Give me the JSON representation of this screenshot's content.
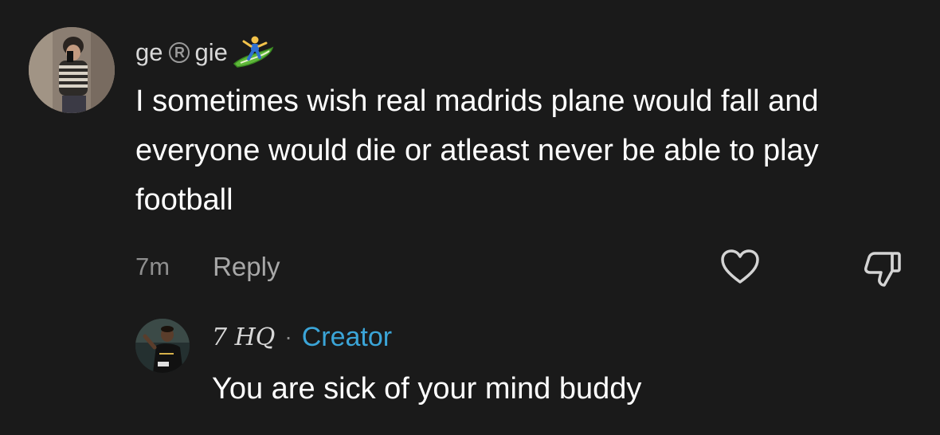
{
  "comment": {
    "username_part1": "ge",
    "registered_symbol": "R",
    "username_part2": "gie",
    "username_emoji": "surfer-icon",
    "text": "I sometimes wish real madrids plane would fall and everyone would die or atleast never be able to play football",
    "timestamp": "7m",
    "reply_label": "Reply",
    "like_icon": "heart-outline-icon",
    "dislike_icon": "thumbs-down-outline-icon"
  },
  "reply": {
    "username": "7 HQ",
    "separator": "·",
    "badge": "Creator",
    "text": "You are sick of your mind buddy"
  },
  "colors": {
    "background": "#1a1a1a",
    "primary_text": "#ffffff",
    "secondary_text": "#8e8e8e",
    "creator_accent": "#3ba5d8"
  }
}
